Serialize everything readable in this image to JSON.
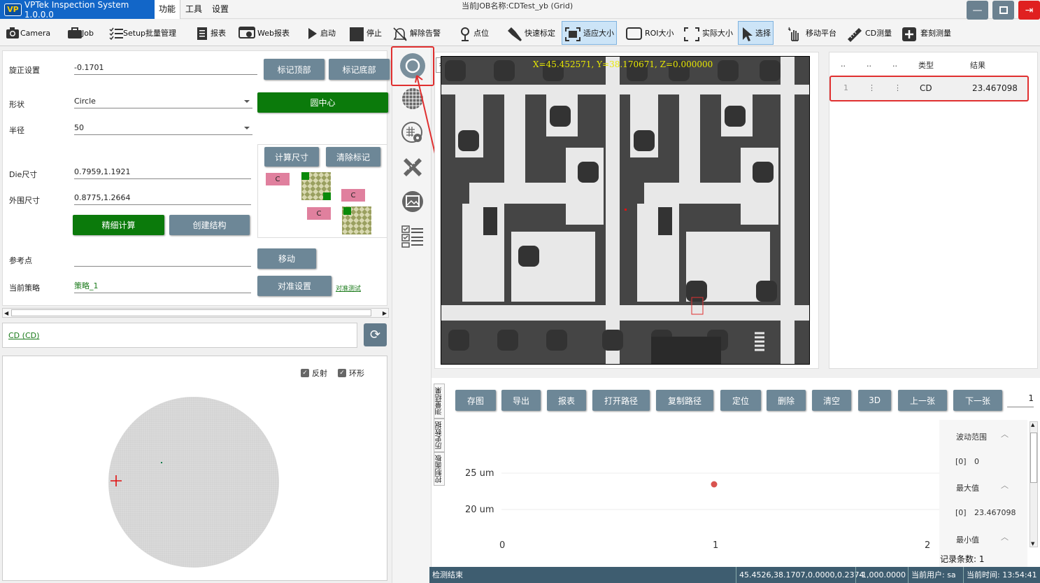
{
  "app": {
    "logo": "VP",
    "title": "VPTek Inspection System 1.0.0.0"
  },
  "menu": [
    "功能",
    "工具",
    "设置"
  ],
  "job": {
    "label": "当前JOB名称:",
    "name": "CDTest_yb (Grid)"
  },
  "toolbar": [
    {
      "label": "Camera",
      "icon": "camera-icon"
    },
    {
      "label": "Job",
      "icon": "briefcase-icon"
    },
    {
      "label": "Setup批量管理",
      "icon": "checklist-icon"
    },
    {
      "label": "报表",
      "icon": "report-icon"
    },
    {
      "label": "Web报表",
      "icon": "web-icon"
    },
    {
      "label": "启动",
      "icon": "play-icon"
    },
    {
      "label": "停止",
      "icon": "stop-icon"
    },
    {
      "label": "解除告警",
      "icon": "bell-off-icon"
    },
    {
      "label": "点位",
      "icon": "pin-icon"
    },
    {
      "label": "快速标定",
      "icon": "wrench-icon"
    },
    {
      "label": "适应大小",
      "icon": "fit-icon"
    },
    {
      "label": "ROI大小",
      "icon": "roi-icon"
    },
    {
      "label": "实际大小",
      "icon": "expand-icon"
    },
    {
      "label": "选择",
      "icon": "cursor-icon"
    },
    {
      "label": "移动平台",
      "icon": "hand-icon"
    },
    {
      "label": "CD测量",
      "icon": "ruler-icon"
    },
    {
      "label": "套刻测量",
      "icon": "plus-box-icon"
    }
  ],
  "form": {
    "rotation_label": "旋正设置",
    "rotation_value": "-0.1701",
    "mark_top": "标记顶部",
    "mark_bottom": "标记底部",
    "shape_label": "形状",
    "shape_value": "Circle",
    "circle_center": "圆中心",
    "radius_label": "半径",
    "radius_value": "50",
    "calc_size": "计算尺寸",
    "clear_marks": "清除标记",
    "die_label": "Die尺寸",
    "die_value": "0.7959,1.1921",
    "outer_label": "外围尺寸",
    "outer_value": "0.8775,1.2664",
    "fine_calc": "精细计算",
    "create_struct": "创建结构",
    "ref_label": "参考点",
    "ref_value": "",
    "move": "移动",
    "strategy_label": "当前策略",
    "strategy_value": "策略_1",
    "align_settings": "对准设置",
    "align_test": "对准测试",
    "diag_c": "C"
  },
  "cd_link": "CD (CD)",
  "wafer": {
    "reflect_label": "反射",
    "ring_label": "环形",
    "check_mark": "✓"
  },
  "view": {
    "expand": ">",
    "coord": "X=45.452571, Y=38.170671, Z=0.000000"
  },
  "results": {
    "headers": [
      "..",
      "..",
      "..",
      "类型",
      "结果"
    ],
    "rows": [
      {
        "c1": "1",
        "c2": "⋮",
        "c3": "⋮",
        "type": "CD",
        "result": "23.467098"
      }
    ]
  },
  "bottom": {
    "buttons": [
      "存图",
      "导出",
      "报表",
      "打开路径",
      "复制路径",
      "定位",
      "删除",
      "清空",
      "3D",
      "上一张",
      "下一张"
    ],
    "page": "1",
    "tabs": [
      "测量结果",
      "历史数据",
      "控制面板"
    ],
    "chart": {
      "ytick1": "25 um",
      "ytick2": "20 um",
      "xticks": [
        "0",
        "1",
        "2"
      ]
    },
    "stats": {
      "range_label": "波动范围",
      "range_index": "[0]",
      "range_value": "0",
      "max_label": "最大值",
      "max_index": "[0]",
      "max_value": "23.467098",
      "min_label": "最小值",
      "count": "记录条数: 1"
    }
  },
  "status": {
    "state": "检测结束",
    "position": "45.4526,38.1707,0.0000,0.2374",
    "value": "-1,000.0000",
    "user": "当前用户: sa",
    "time": "当前时间: 13:54:41"
  },
  "colors": {
    "accent": "#1266c8",
    "green": "#0b7a0b",
    "steel": "#6d8797",
    "highlight": "#e03030"
  }
}
